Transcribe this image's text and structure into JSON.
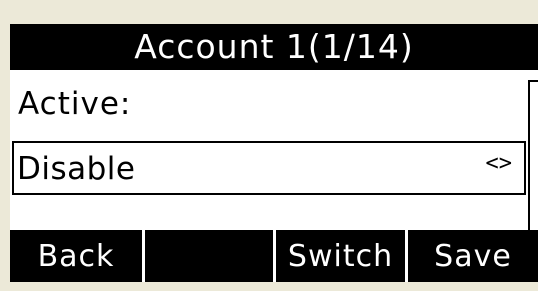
{
  "header": {
    "title": "Account 1(1/14)"
  },
  "field": {
    "label": "Active:",
    "value": "Disable",
    "arrows": "<>"
  },
  "softkeys": [
    "Back",
    "",
    "Switch",
    "Save"
  ],
  "colors": {
    "background": "#ece9d8",
    "lcd": "#ffffff",
    "bar": "#000000",
    "text_on_bar": "#ffffff"
  }
}
